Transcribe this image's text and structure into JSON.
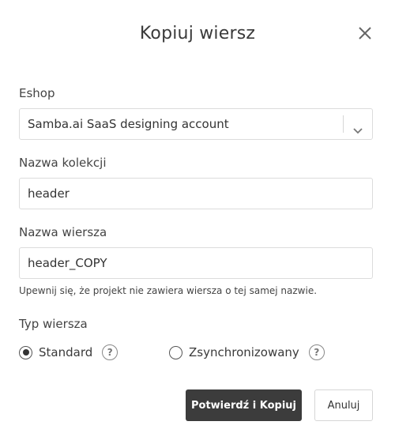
{
  "dialog": {
    "title": "Kopiuj wiersz",
    "close_icon": "close-icon"
  },
  "eshop": {
    "label": "Eshop",
    "selected": "Samba.ai SaaS designing account",
    "arrow_icon": "chevron-down-icon"
  },
  "collection": {
    "label": "Nazwa kolekcji",
    "value": "header"
  },
  "row_name": {
    "label": "Nazwa wiersza",
    "value": "header_COPY",
    "hint": "Upewnij się, że projekt nie zawiera wiersza o tej samej nazwie."
  },
  "row_type": {
    "label": "Typ wiersza",
    "options": [
      {
        "label": "Standard",
        "selected": true,
        "help_icon": "help-icon"
      },
      {
        "label": "Zsynchronizowany",
        "selected": false,
        "help_icon": "help-icon"
      }
    ]
  },
  "actions": {
    "confirm_label": "Potwierdź i Kopiuj",
    "cancel_label": "Anuluj"
  },
  "colors": {
    "primary_button": "#3c3c3c",
    "text": "#3a3a3a",
    "border": "#dcdcdc"
  }
}
